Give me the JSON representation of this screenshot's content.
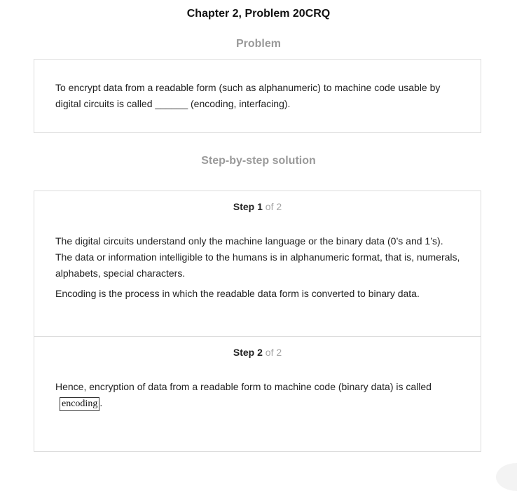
{
  "header": {
    "title": "Chapter 2, Problem 20CRQ"
  },
  "problem": {
    "heading": "Problem",
    "text_line1": "To encrypt data from a readable form (such as alphanumeric) to machine code usable by",
    "text_line2": "digital circuits is called ______ (encoding, interfacing)."
  },
  "solution": {
    "heading": "Step-by-step solution",
    "steps": [
      {
        "word": "Step",
        "number": "1",
        "of": "of 2",
        "paragraphs": [
          "The digital circuits understand only the machine language or the binary data (0’s and 1’s). The data or information intelligible to the humans is in alphanumeric format, that is, numerals, alphabets, special characters.",
          "Encoding is the process in which the readable data form is converted to binary data."
        ]
      },
      {
        "word": "Step",
        "number": "2",
        "of": "of 2",
        "text": "Hence, encryption of data from a readable form to machine code (binary data) is called",
        "answer": "encoding",
        "trailing": "."
      }
    ]
  }
}
